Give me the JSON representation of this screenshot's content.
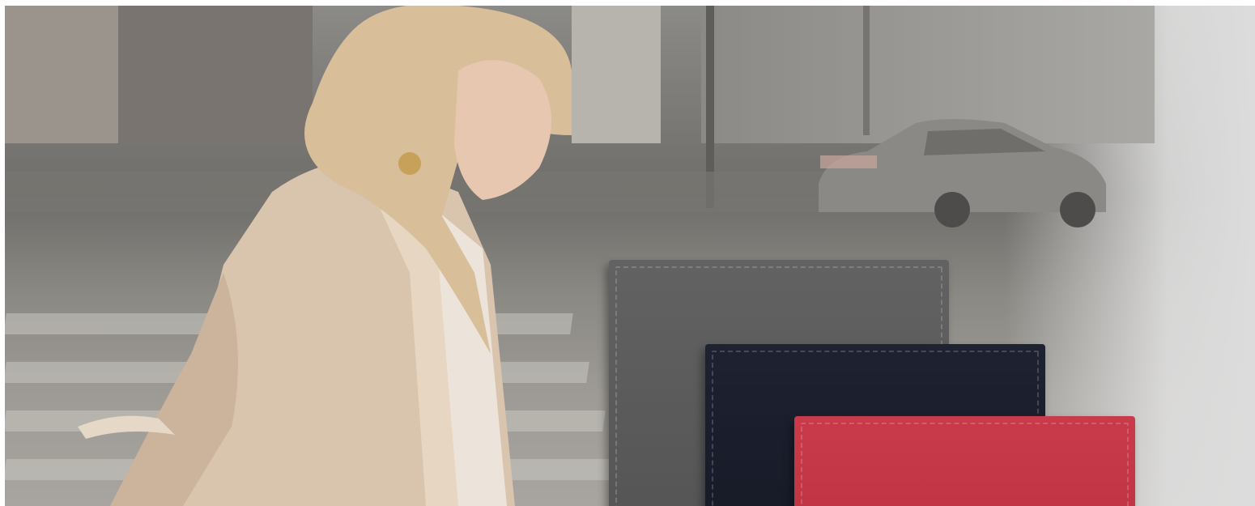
{
  "banner": {
    "photo": {
      "subject": "woman-in-beige-coat",
      "setting": "city-street"
    },
    "products": [
      {
        "name": "wallet-gray",
        "color": "#5c5c5d"
      },
      {
        "name": "wallet-navy",
        "color": "#1b1e2c"
      },
      {
        "name": "wallet-red",
        "color": "#c53847"
      }
    ],
    "colors": {
      "background": "#ffffff",
      "fade": "#dcdcdc",
      "coat": "#d9c4ad",
      "hair": "#d8bf9a"
    }
  }
}
